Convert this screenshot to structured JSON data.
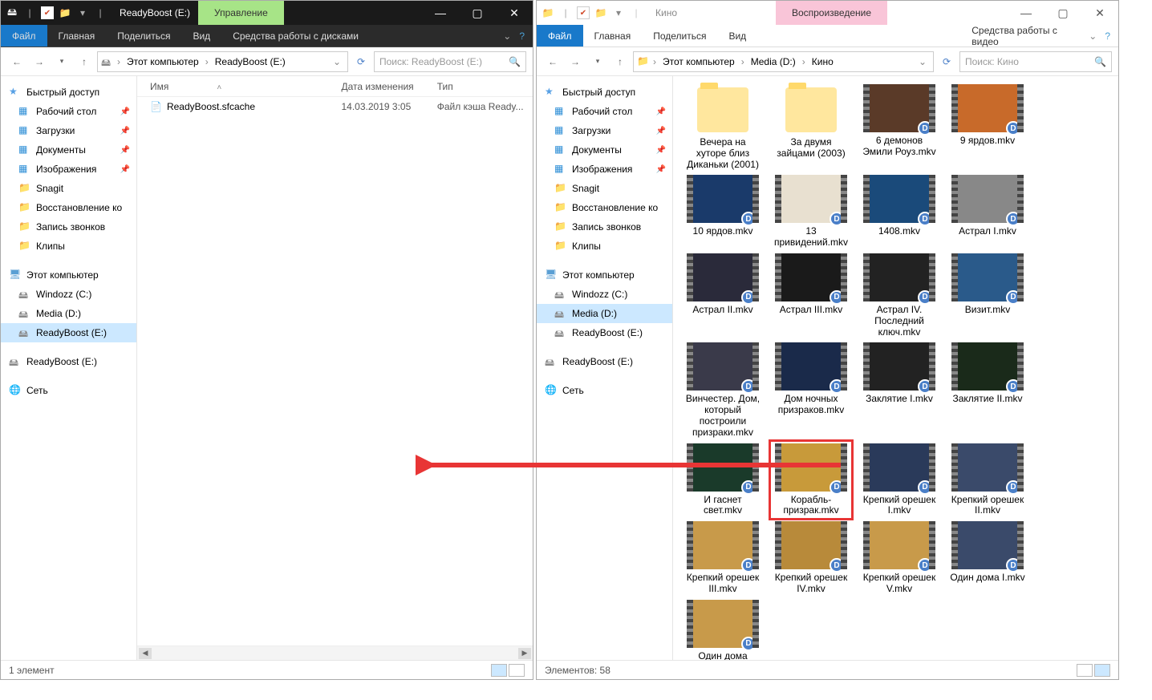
{
  "left": {
    "title": "ReadyBoost (E:)",
    "context_tab": "Управление",
    "context_sub": "Средства работы с дисками",
    "ribbon": {
      "file": "Файл",
      "tabs": [
        "Главная",
        "Поделиться",
        "Вид"
      ]
    },
    "breadcrumb": [
      "Этот компьютер",
      "ReadyBoost (E:)"
    ],
    "search_placeholder": "Поиск: ReadyBoost (E:)",
    "columns": {
      "name": "Имя",
      "date": "Дата изменения",
      "type": "Тип"
    },
    "files": [
      {
        "name": "ReadyBoost.sfcache",
        "date": "14.03.2019 3:05",
        "type": "Файл кэша Ready..."
      }
    ],
    "status": "1 элемент"
  },
  "right": {
    "title": "Кино",
    "context_tab": "Воспроизведение",
    "context_sub": "Средства работы с видео",
    "ribbon": {
      "file": "Файл",
      "tabs": [
        "Главная",
        "Поделиться",
        "Вид"
      ]
    },
    "breadcrumb": [
      "Этот компьютер",
      "Media (D:)",
      "Кино"
    ],
    "search_placeholder": "Поиск: Кино",
    "status": "Элементов: 58",
    "items": [
      {
        "label": "Вечера на хуторе близ Диканьки (2001)",
        "kind": "folder"
      },
      {
        "label": "За двумя зайцами (2003)",
        "kind": "folder"
      },
      {
        "label": "6 демонов Эмили Роуз.mkv",
        "kind": "video",
        "bg": "#5a3a28"
      },
      {
        "label": "9 ярдов.mkv",
        "kind": "video",
        "bg": "#c86a2a"
      },
      {
        "label": "10 ярдов.mkv",
        "kind": "video",
        "bg": "#1a3a6a"
      },
      {
        "label": "13 привидений.mkv",
        "kind": "video",
        "bg": "#e8e0d0"
      },
      {
        "label": "1408.mkv",
        "kind": "video",
        "bg": "#1a4a7a"
      },
      {
        "label": "Астрал I.mkv",
        "kind": "video",
        "bg": "#888"
      },
      {
        "label": "Астрал II.mkv",
        "kind": "video",
        "bg": "#2a2a3a"
      },
      {
        "label": "Астрал III.mkv",
        "kind": "video",
        "bg": "#1a1a1a"
      },
      {
        "label": "Астрал IV. Последний ключ.mkv",
        "kind": "video",
        "bg": "#222"
      },
      {
        "label": "Визит.mkv",
        "kind": "video",
        "bg": "#2a5a8a"
      },
      {
        "label": "Винчестер. Дом, который построили призраки.mkv",
        "kind": "video",
        "bg": "#3a3a4a"
      },
      {
        "label": "Дом ночных призраков.mkv",
        "kind": "video",
        "bg": "#1a2a4a"
      },
      {
        "label": "Заклятие I.mkv",
        "kind": "video",
        "bg": "#222"
      },
      {
        "label": "Заклятие II.mkv",
        "kind": "video",
        "bg": "#1a2a1a"
      },
      {
        "label": "И гаснет свет.mkv",
        "kind": "video",
        "bg": "#1a3a2a"
      },
      {
        "label": "Корабль-призрак.mkv",
        "kind": "video",
        "bg": "#c89a3a",
        "highlight": true
      },
      {
        "label": "Крепкий орешек I.mkv",
        "kind": "video",
        "bg": "#2a3a5a"
      },
      {
        "label": "Крепкий орешек II.mkv",
        "kind": "video",
        "bg": "#3a4a6a"
      },
      {
        "label": "Крепкий орешек III.mkv",
        "kind": "video",
        "bg": "#c89a4a"
      },
      {
        "label": "Крепкий орешек IV.mkv",
        "kind": "video",
        "bg": "#b88a3a"
      },
      {
        "label": "Крепкий орешек V.mkv",
        "kind": "video",
        "bg": "#c89a4a"
      },
      {
        "label": "Один дома I.mkv",
        "kind": "video",
        "bg": "#3a4a6a"
      },
      {
        "label": "Один дома II.mkv",
        "kind": "video",
        "bg": "#c89a4a"
      }
    ]
  },
  "sidebar": {
    "quick": "Быстрый доступ",
    "items_pinned": [
      {
        "label": "Рабочий стол",
        "icon": "ic-desk"
      },
      {
        "label": "Загрузки",
        "icon": "ic-dl"
      },
      {
        "label": "Документы",
        "icon": "ic-doc"
      },
      {
        "label": "Изображения",
        "icon": "ic-img"
      }
    ],
    "items_plain": [
      {
        "label": "Snagit"
      },
      {
        "label": "Восстановление ко"
      },
      {
        "label": "Запись звонков"
      },
      {
        "label": "Клипы"
      }
    ],
    "pc": "Этот компьютер",
    "drives": [
      {
        "label": "Windozz (C:)"
      },
      {
        "label": "Media (D:)"
      },
      {
        "label": "ReadyBoost (E:)"
      }
    ],
    "removable": "ReadyBoost (E:)",
    "network": "Сеть"
  }
}
